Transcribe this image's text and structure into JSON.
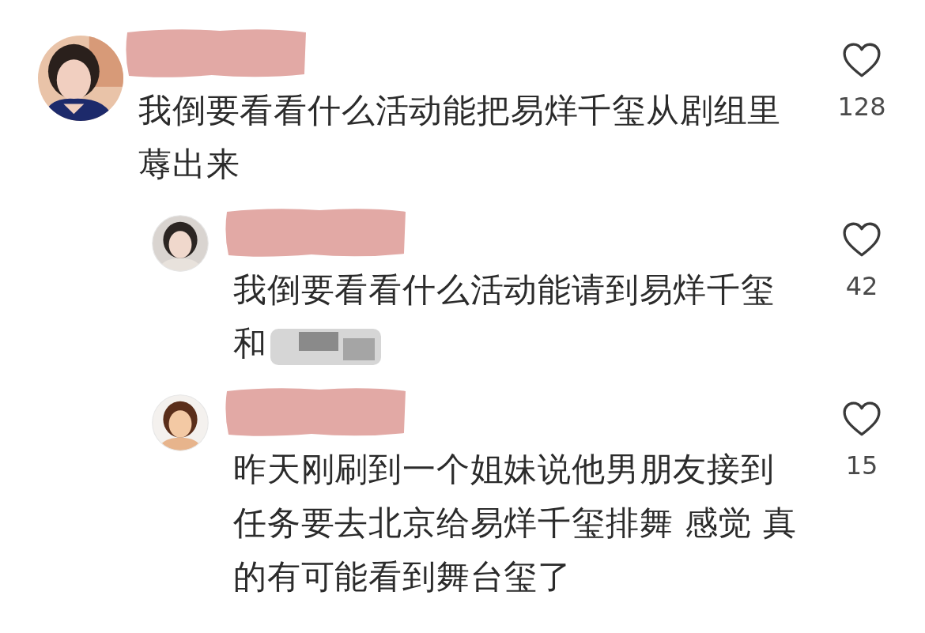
{
  "comments": [
    {
      "author": {
        "redacted": true
      },
      "text": "我倒要看看什么活动能把易烊千玺从剧组里蓐出来",
      "blurred_tail": false,
      "likes": "128",
      "liked": false,
      "replies": [
        {
          "author": {
            "redacted": true
          },
          "text": "我倒要看看什么活动能请到易烊千玺和",
          "blurred_tail": true,
          "likes": "42",
          "liked": false
        },
        {
          "author": {
            "redacted": true
          },
          "text": "昨天刚刷到一个姐妹说他男朋友接到任务要去北京给易烊千玺排舞 感觉 真的有可能看到舞台玺了",
          "blurred_tail": false,
          "likes": "15",
          "liked": false
        }
      ]
    }
  ]
}
